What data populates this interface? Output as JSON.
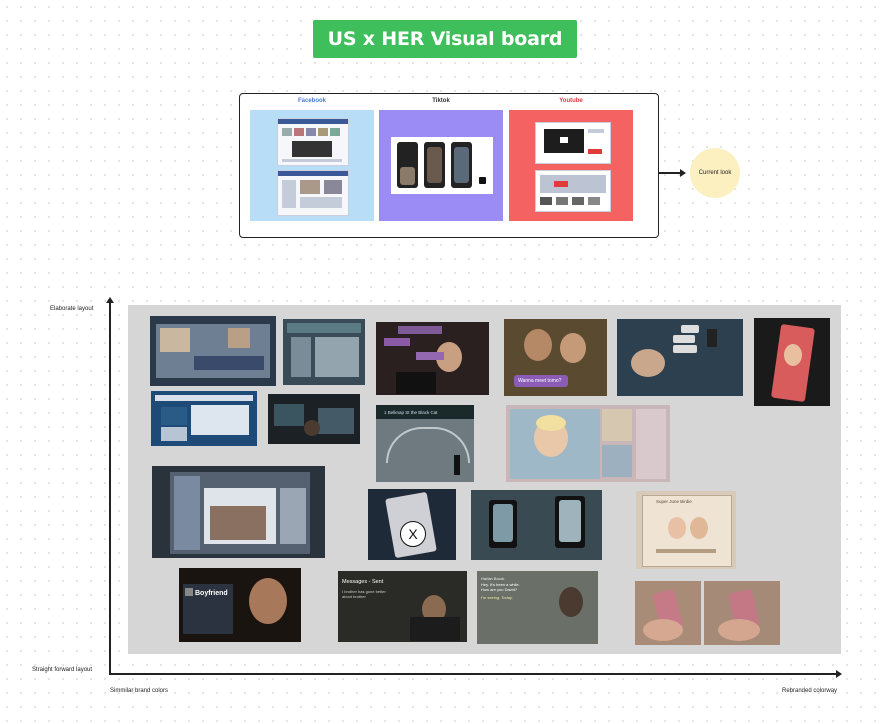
{
  "title": "US x HER Visual board",
  "platforms": [
    {
      "name": "Facebook",
      "color": "#4a7bd0",
      "bg": "#b8ddf7"
    },
    {
      "name": "Tiktok",
      "color": "#333333",
      "bg": "#9b8cf5"
    },
    {
      "name": "Youtube",
      "color": "#e03a3a",
      "bg": "#f56262"
    }
  ],
  "current_look": "Current look",
  "axis": {
    "y_top": "Elaborate layout",
    "y_bottom": "Straight  forward layout",
    "x_left": "Simmilar brand colors",
    "x_right": "Rebranded colorway"
  },
  "stills": {
    "bubble_movie": "Wanna meet tomo?",
    "bubble_hey": "Hey",
    "station_sign": "1 Belknap St the Black Cat",
    "profile_name": "Super June Birdie",
    "boyfriend": "Boyfriend",
    "messages_header": "Messages - Sent",
    "messages_body": "I brother has gone better\nabout brother",
    "chat_name": "Harlan Brook",
    "chat_body": "Hey. It's been a while.\nHow are you David?",
    "chat_reply": "I'm seeing. Today.",
    "x_mark": "X"
  }
}
